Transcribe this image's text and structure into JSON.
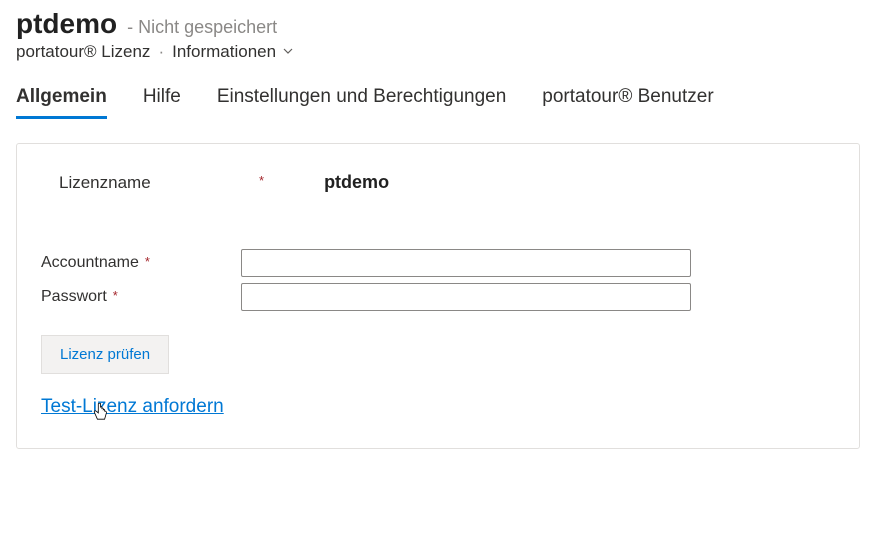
{
  "header": {
    "title": "ptdemo",
    "save_status": "- Nicht gespeichert"
  },
  "breadcrumb": {
    "parent": "portatour® Lizenz",
    "separator": "·",
    "dropdown_label": "Informationen"
  },
  "tabs": [
    {
      "label": "Allgemein",
      "active": true
    },
    {
      "label": "Hilfe",
      "active": false
    },
    {
      "label": "Einstellungen und Berechtigungen",
      "active": false
    },
    {
      "label": "portatour® Benutzer",
      "active": false
    }
  ],
  "form": {
    "license_name": {
      "label": "Lizenzname",
      "required": "*",
      "value": "ptdemo"
    },
    "account_name": {
      "label": "Accountname",
      "required": "*",
      "value": ""
    },
    "password": {
      "label": "Passwort",
      "required": "*",
      "value": ""
    }
  },
  "actions": {
    "check_license": "Lizenz prüfen",
    "request_test_license": "Test-Lizenz anfordern"
  }
}
